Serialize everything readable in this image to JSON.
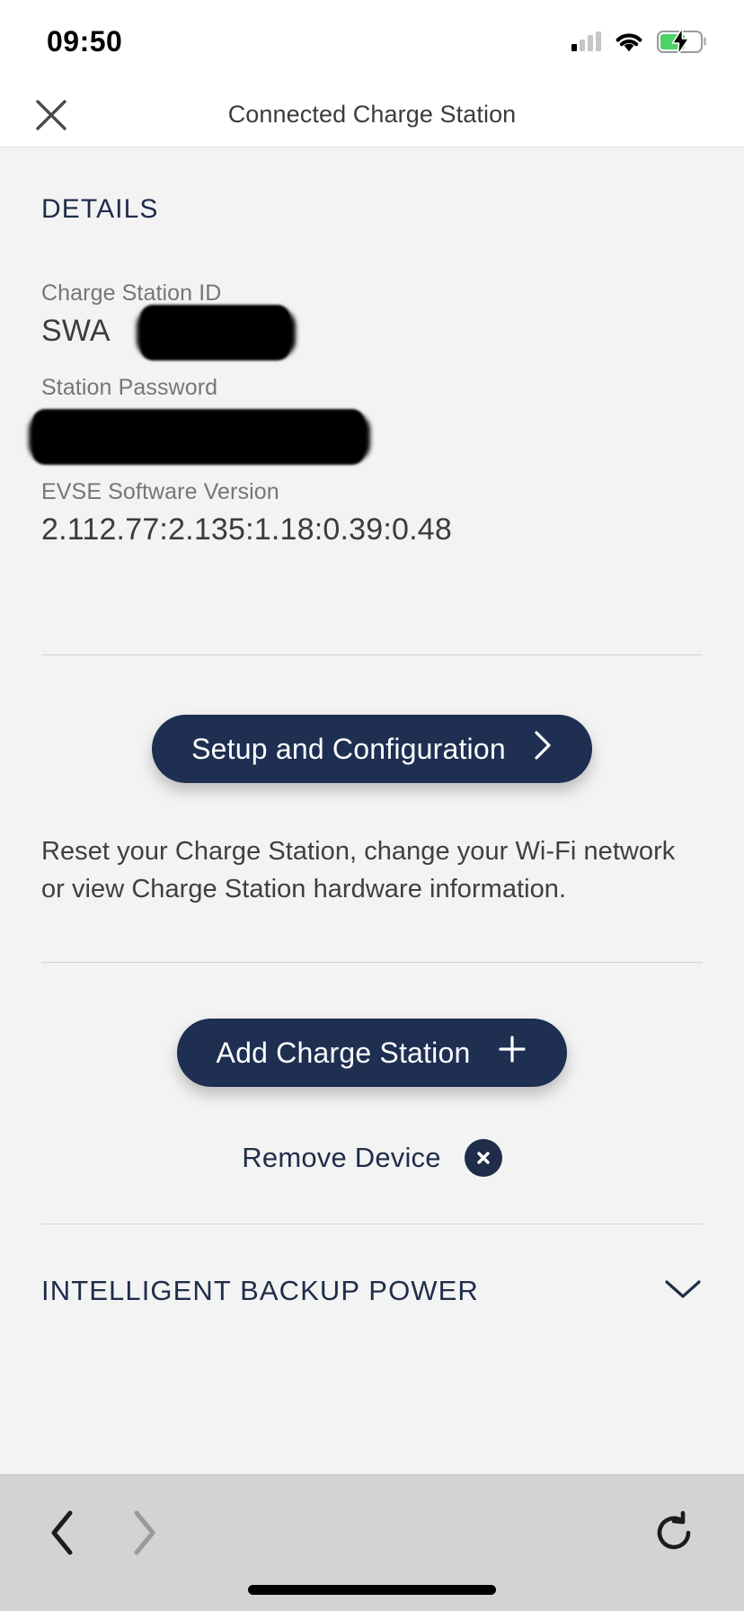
{
  "status_bar": {
    "time": "09:50",
    "signal_icon": "cellular-signal-icon",
    "signal_bars_total": 4,
    "signal_bars_filled": 1,
    "wifi_icon": "wifi-icon",
    "battery_icon": "battery-charging-icon",
    "battery_level_percent": 62,
    "battery_color": "#4cd267"
  },
  "header": {
    "close_icon": "close-icon",
    "title": "Connected Charge Station"
  },
  "details": {
    "section_title": "DETAILS",
    "fields": [
      {
        "label": "Charge Station ID",
        "value": "SWA",
        "redacted": true
      },
      {
        "label": "Station Password",
        "value": "",
        "redacted": true
      },
      {
        "label": "EVSE Software Version",
        "value": "2.112.77:2.135:1.18:0.39:0.48",
        "redacted": false
      }
    ]
  },
  "setup": {
    "button_label": "Setup and Configuration",
    "button_icon": "chevron-right-icon",
    "helper_text": "Reset your Charge Station, change your Wi-Fi network or view Charge Station hardware information."
  },
  "device_actions": {
    "add_label": "Add Charge Station",
    "add_icon": "plus-icon",
    "remove_label": "Remove Device",
    "remove_icon": "circle-x-icon"
  },
  "backup_power": {
    "title": "INTELLIGENT BACKUP POWER",
    "chevron_icon": "chevron-down-icon",
    "expanded": false
  },
  "browser_bar": {
    "back_icon": "chevron-left-icon",
    "back_enabled": true,
    "forward_icon": "chevron-right-icon",
    "forward_enabled": false,
    "reload_icon": "reload-icon"
  },
  "theme": {
    "accent_navy": "#1e2f52",
    "page_background": "#f3f3f3",
    "browser_bar_background": "#d3d3d3",
    "label_gray": "#767676"
  }
}
